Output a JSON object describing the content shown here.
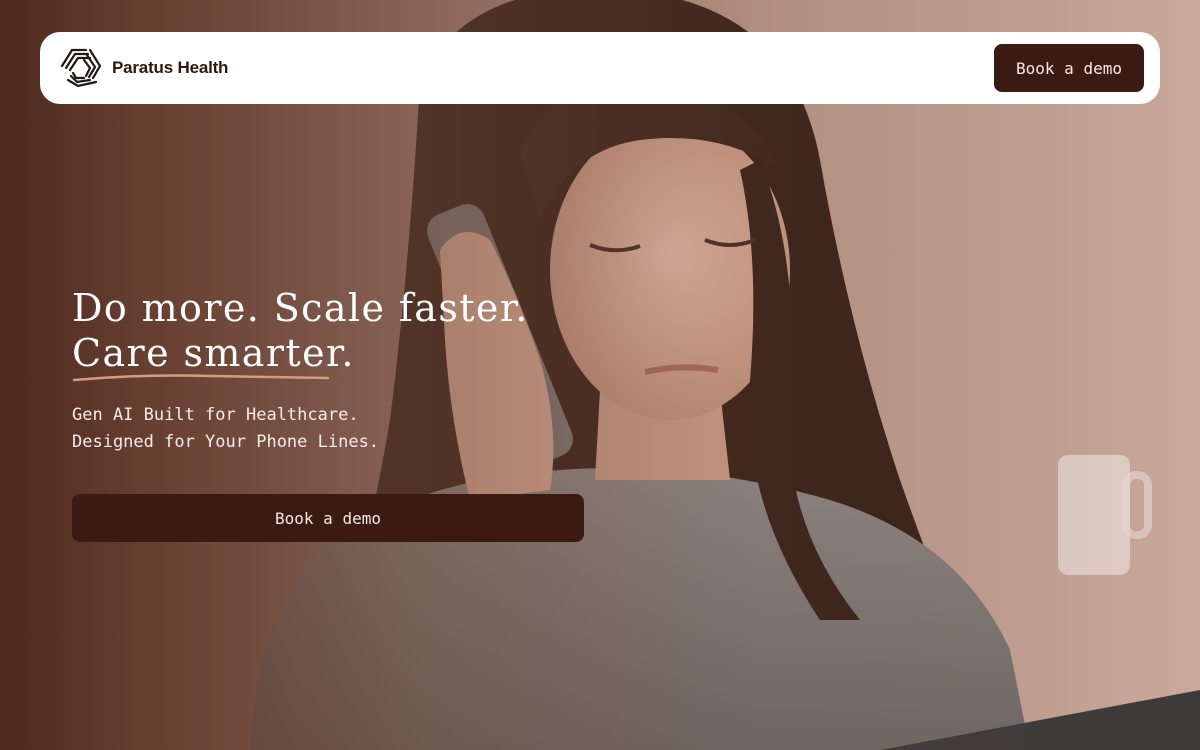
{
  "brand": {
    "name": "Paratus Health",
    "logo_icon": "paratus-logo-icon"
  },
  "nav": {
    "cta_label": "Book a demo"
  },
  "hero": {
    "headline_line1": "Do more. Scale faster.",
    "headline_line2": "Care smarter.",
    "subhead_line1": "Gen AI Built for Healthcare.",
    "subhead_line2": "Designed for Your Phone Lines.",
    "cta_label": "Book a demo",
    "photo_subject": "woman-on-phone-image"
  },
  "colors": {
    "primary_dark": "#3b1a14",
    "accent_underline": "#d49a88",
    "overlay_brown": "#4a261a",
    "nav_background": "#ffffff"
  }
}
